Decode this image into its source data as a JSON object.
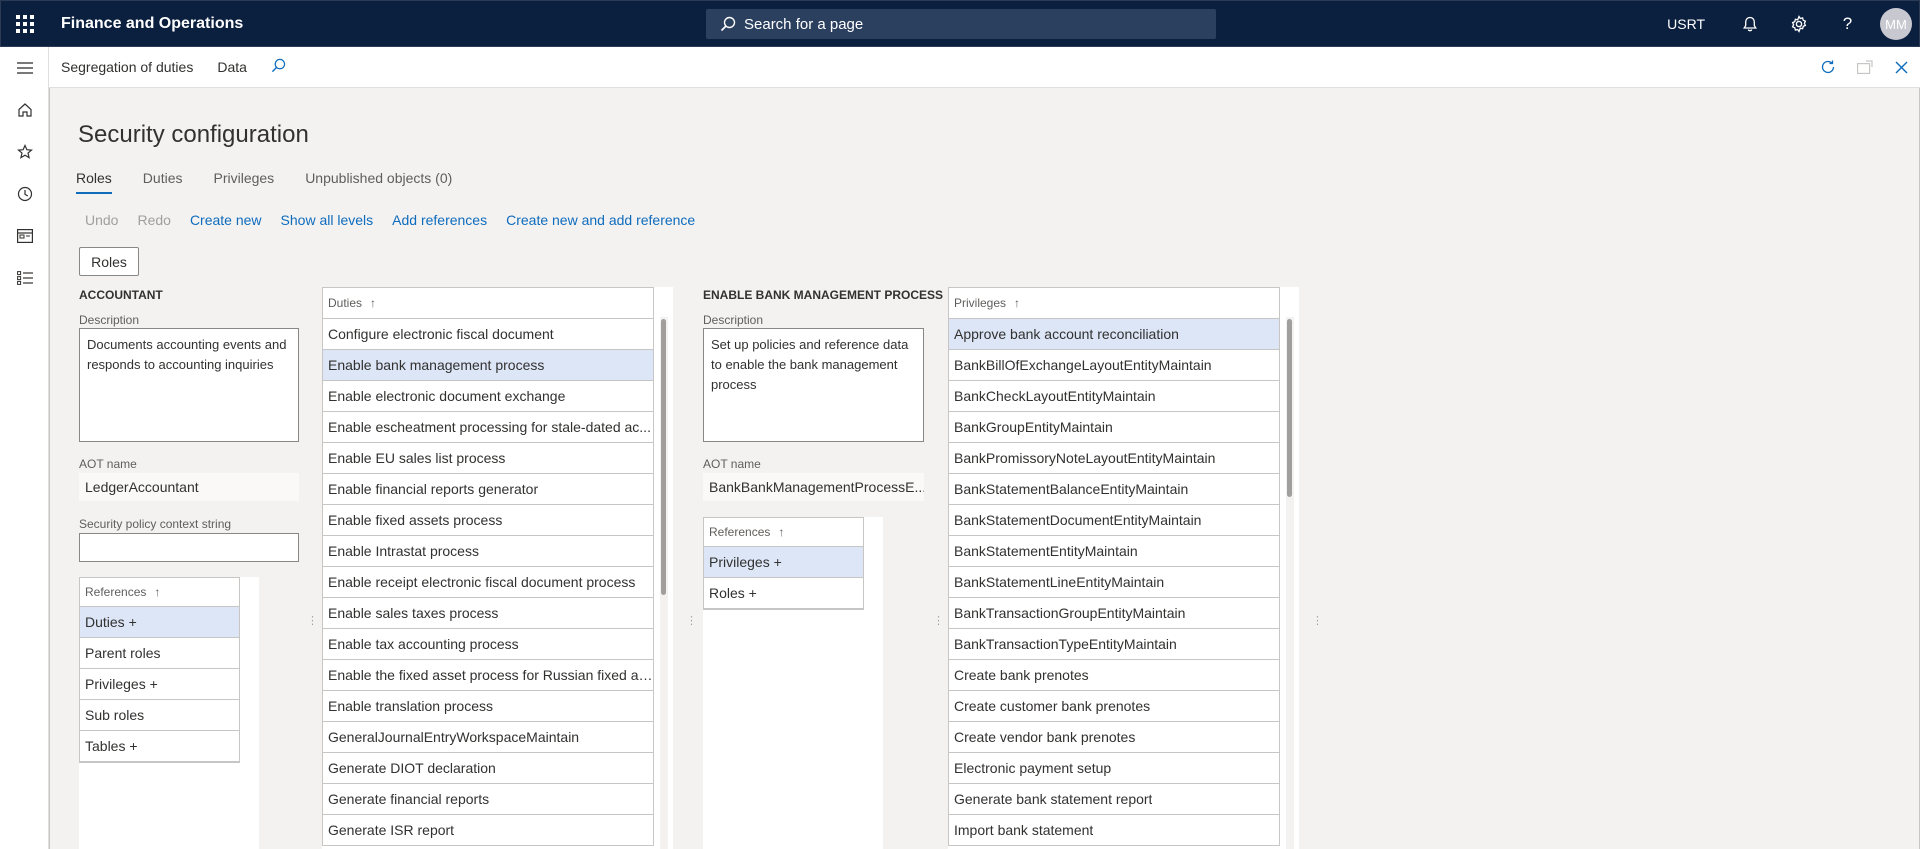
{
  "topbar": {
    "app_title": "Finance and Operations",
    "search_placeholder": "Search for a page",
    "company": "USRT",
    "avatar_initials": "MM"
  },
  "actionbar": {
    "breadcrumb": "Segregation of duties",
    "data": "Data"
  },
  "page": {
    "title": "Security configuration",
    "tabs": [
      "Roles",
      "Duties",
      "Privileges",
      "Unpublished objects (0)"
    ],
    "active_tab": "Roles"
  },
  "toolbar": {
    "undo": "Undo",
    "redo": "Redo",
    "create_new": "Create new",
    "show_all_levels": "Show all levels",
    "add_references": "Add references",
    "create_new_and_add_reference": "Create new and add reference"
  },
  "roles_button": "Roles",
  "role": {
    "name": "ACCOUNTANT",
    "description_label": "Description",
    "description": "Documents accounting events and responds to accounting inquiries",
    "aot_label": "AOT name",
    "aot_name": "LedgerAccountant",
    "policy_label": "Security policy context string",
    "policy_value": "",
    "references_header": "References",
    "references": [
      "Duties +",
      "Parent roles",
      "Privileges +",
      "Sub roles",
      "Tables +"
    ],
    "selected_reference": 0
  },
  "duties": {
    "header": "Duties",
    "items": [
      "Configure electronic fiscal document",
      "Enable bank management process",
      "Enable electronic document exchange",
      "Enable escheatment processing for stale-dated ac...",
      "Enable EU sales list process",
      "Enable financial reports generator",
      "Enable fixed assets process",
      "Enable Intrastat process",
      "Enable receipt electronic fiscal document process",
      "Enable sales taxes process",
      "Enable tax accounting process",
      "Enable the fixed asset process for Russian fixed as...",
      "Enable translation process",
      "GeneralJournalEntryWorkspaceMaintain",
      "Generate DIOT declaration",
      "Generate financial reports",
      "Generate ISR report"
    ],
    "selected": 1
  },
  "duty_detail": {
    "name": "ENABLE BANK MANAGEMENT PROCESS",
    "description_label": "Description",
    "description": "Set up policies and reference data to enable the bank management process",
    "aot_label": "AOT name",
    "aot_name": "BankBankManagementProcessE...",
    "references_header": "References",
    "references": [
      "Privileges +",
      "Roles +"
    ],
    "selected_reference": 0
  },
  "privileges": {
    "header": "Privileges",
    "items": [
      "Approve bank account reconciliation",
      "BankBillOfExchangeLayoutEntityMaintain",
      "BankCheckLayoutEntityMaintain",
      "BankGroupEntityMaintain",
      "BankPromissoryNoteLayoutEntityMaintain",
      "BankStatementBalanceEntityMaintain",
      "BankStatementDocumentEntityMaintain",
      "BankStatementEntityMaintain",
      "BankStatementLineEntityMaintain",
      "BankTransactionGroupEntityMaintain",
      "BankTransactionTypeEntityMaintain",
      "Create bank prenotes",
      "Create customer bank prenotes",
      "Create vendor bank prenotes",
      "Electronic payment setup",
      "Generate bank statement report",
      "Import bank statement"
    ],
    "selected": 0
  }
}
